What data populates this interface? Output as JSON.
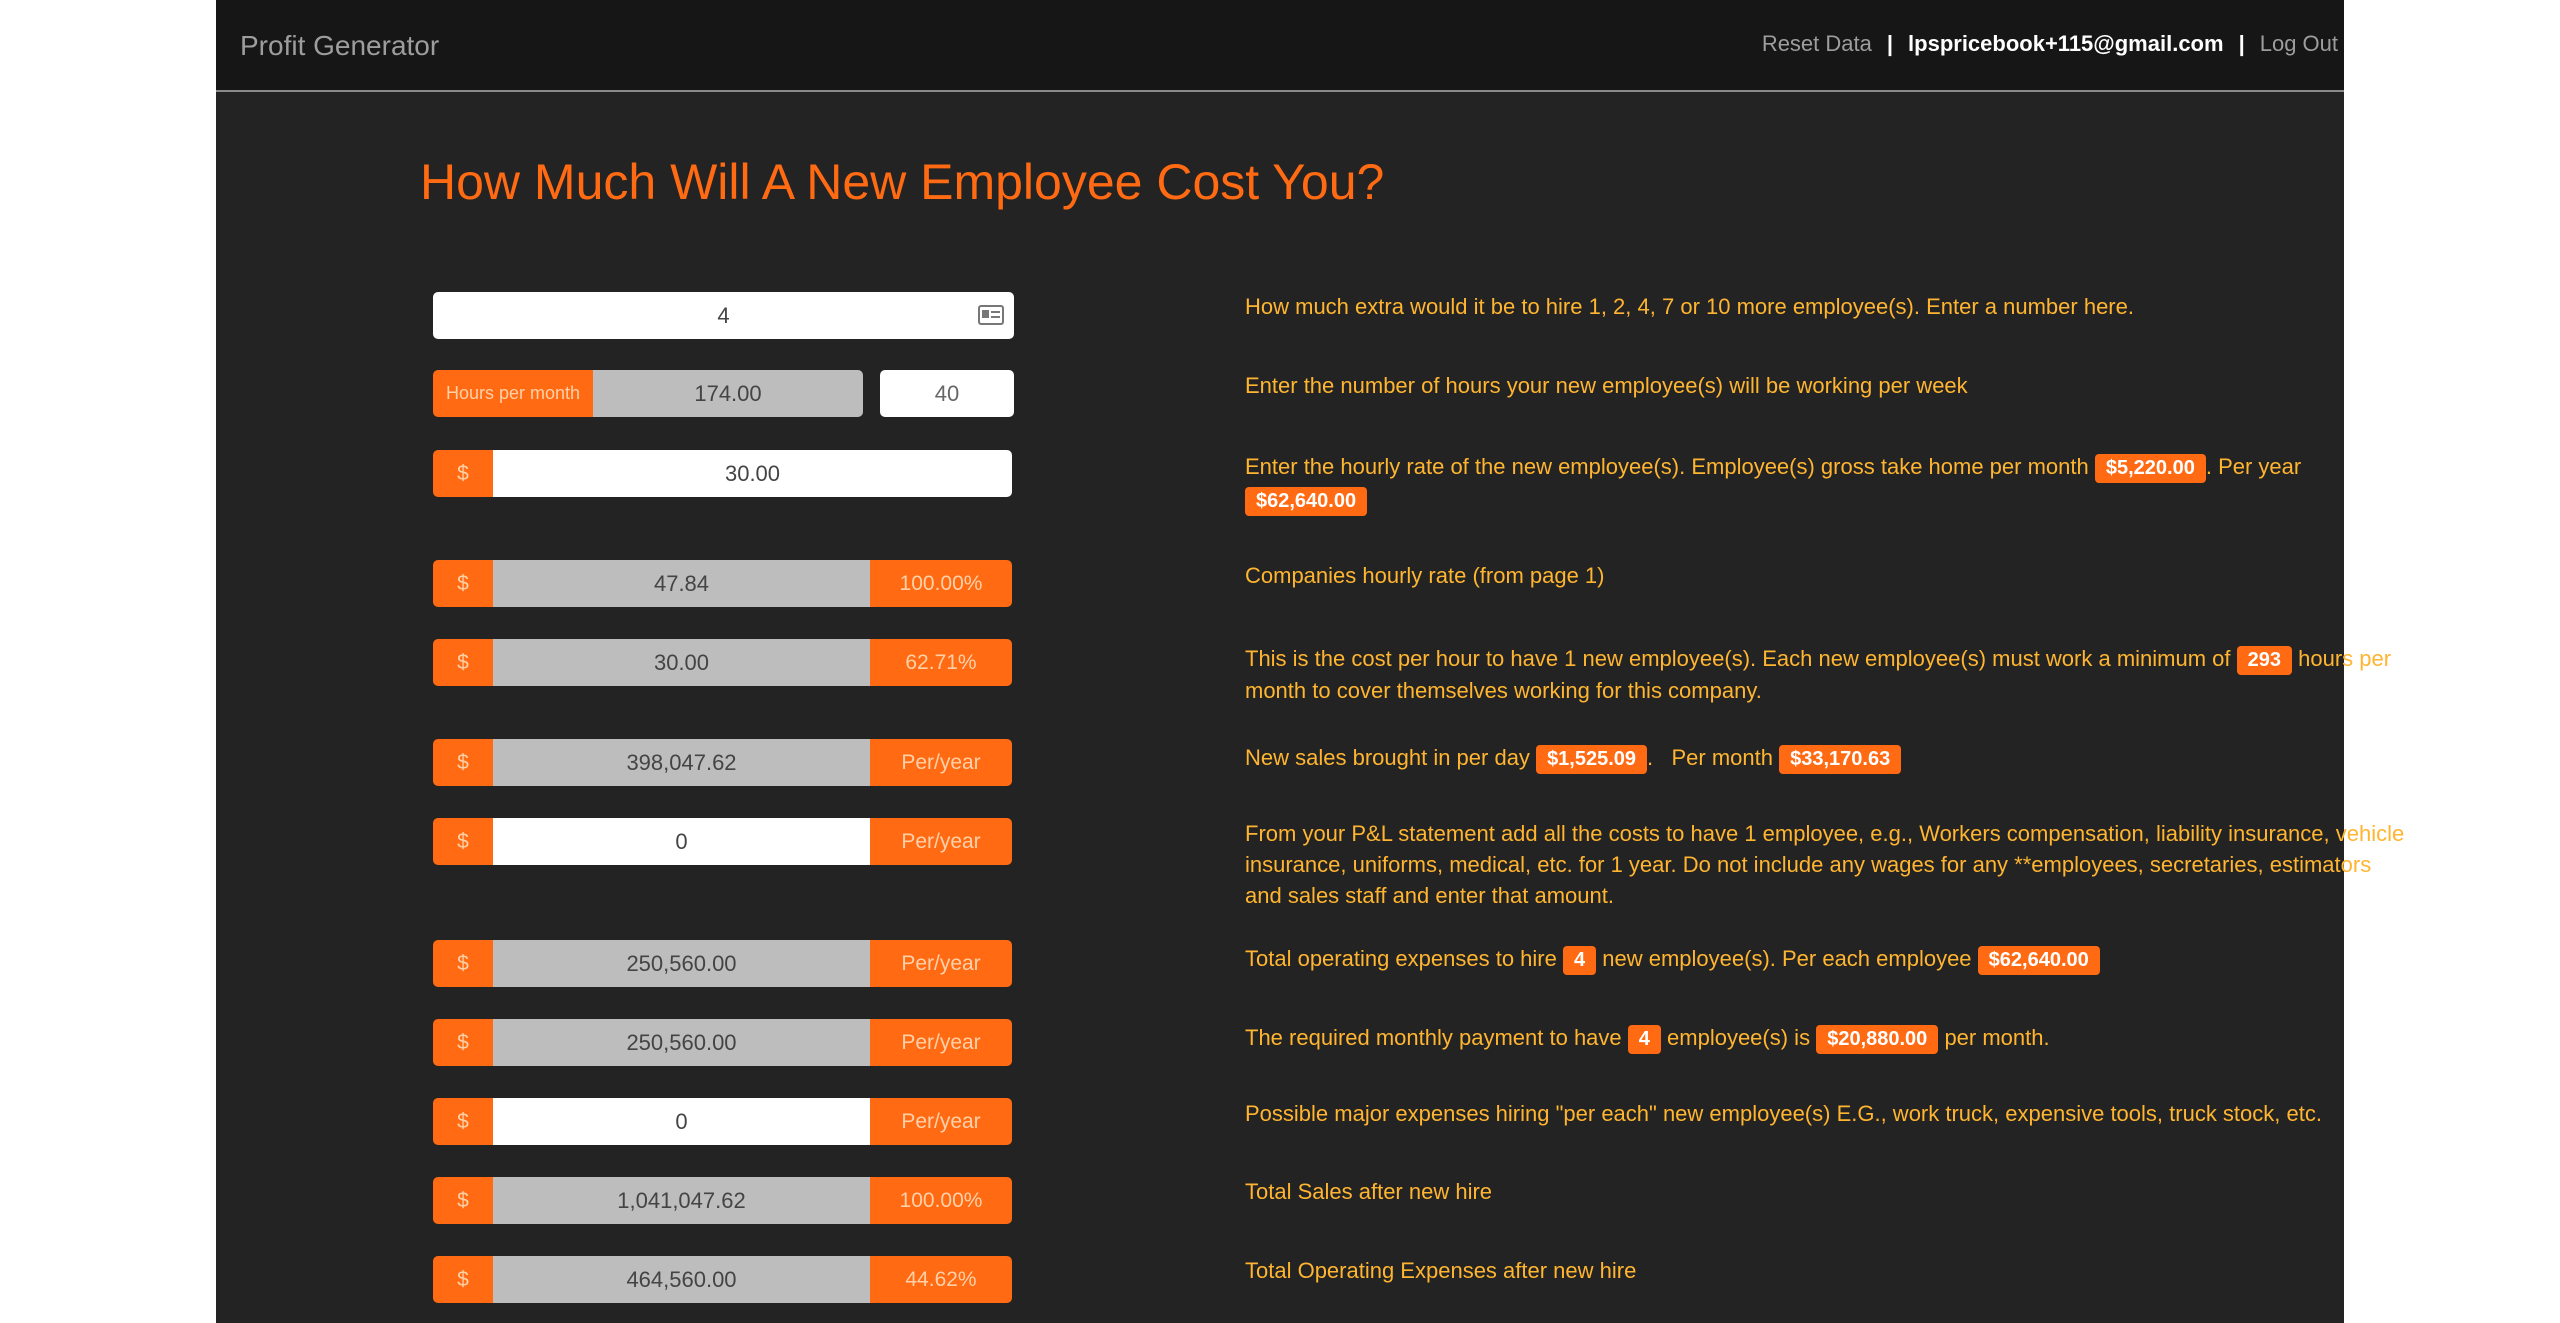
{
  "nav": {
    "brand": "Profit Generator",
    "reset": "Reset Data",
    "separator": "|",
    "user": "lpspricebook+115@gmail.com",
    "logout": "Log Out"
  },
  "page": {
    "title": "How Much Will A New Employee Cost You?"
  },
  "rows": {
    "employees": {
      "value": "4",
      "desc": "How much extra would it be to hire 1, 2, 4, 7 or 10 more employee(s). Enter a number here."
    },
    "hours": {
      "prefix": "Hours per month",
      "value": "174.00",
      "weekly": "40",
      "desc": "Enter the number of hours your new employee(s) will be working per week"
    },
    "rate": {
      "prefix": "$",
      "value": "30.00",
      "desc_a": "Enter the hourly rate of the new employee(s). Employee(s) gross take home per month",
      "month": "$5,220.00",
      "desc_b": ". Per year",
      "year": "$62,640.00"
    },
    "company_rate": {
      "prefix": "$",
      "value": "47.84",
      "suffix": "100.00%",
      "desc": "Companies hourly rate (from page 1)"
    },
    "cost_hour": {
      "prefix": "$",
      "value": "30.00",
      "suffix": "62.71%",
      "desc_a": "This is the cost per hour to have 1 new employee(s). Each new employee(s) must work a minimum of",
      "hours": "293",
      "desc_b": "hours per month to cover themselves working for this company."
    },
    "new_sales": {
      "prefix": "$",
      "value": "398,047.62",
      "suffix": "Per/year",
      "desc_a": "New sales brought in per day",
      "day": "$1,525.09",
      "desc_b": ".   Per month",
      "month": "$33,170.63"
    },
    "pl_costs": {
      "prefix": "$",
      "value": "0",
      "suffix": "Per/year",
      "desc": "From your P&L statement add all the costs to have 1 employee, e.g., Workers compensation, liability insurance, vehicle insurance, uniforms, medical, etc. for 1 year. Do not include any wages for any **employees, secretaries, estimators and sales staff and enter that amount."
    },
    "total_opex": {
      "prefix": "$",
      "value": "250,560.00",
      "suffix": "Per/year",
      "desc_a": "Total operating expenses to hire",
      "count": "4",
      "desc_b": "new employee(s). Per each employee",
      "each": "$62,640.00"
    },
    "monthly_payment": {
      "prefix": "$",
      "value": "250,560.00",
      "suffix": "Per/year",
      "desc_a": "The required monthly payment to have",
      "count": "4",
      "desc_b": "employee(s) is",
      "monthly": "$20,880.00",
      "desc_c": "per month."
    },
    "major_expenses": {
      "prefix": "$",
      "value": "0",
      "suffix": "Per/year",
      "desc": "Possible major expenses hiring \"per each\" new employee(s) E.G., work truck, expensive tools, truck stock, etc."
    },
    "total_sales": {
      "prefix": "$",
      "value": "1,041,047.62",
      "suffix": "100.00%",
      "desc": "Total Sales after new hire"
    },
    "total_opex_after": {
      "prefix": "$",
      "value": "464,560.00",
      "suffix": "44.62%",
      "desc": "Total Operating Expenses after new hire"
    }
  },
  "icons": {
    "input_card": "id-card-icon"
  }
}
